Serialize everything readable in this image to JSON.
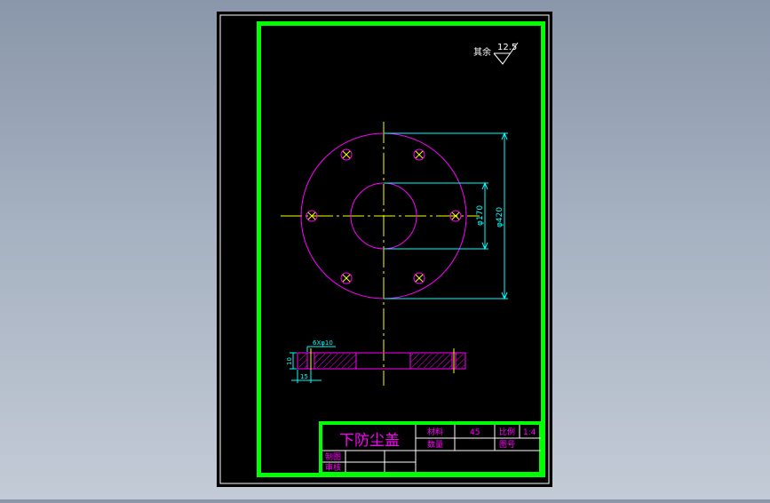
{
  "colors": {
    "background_gradient_top": "#8a97aa",
    "background_gradient_bottom": "#c3cbd6",
    "sheet": "#000000",
    "sheet_border": "#ffffff",
    "drawing_frame": "#00ff00",
    "part_outline": "#ff00ff",
    "centerline": "#ffff00",
    "dimension": "#00ffff",
    "hatch": "#ff00ff",
    "text_yellow": "#ffff00",
    "title_block_lines": "#ffffff"
  },
  "surface_finish": {
    "label": "其余",
    "value": "12.5"
  },
  "dimensions": {
    "inner_diameter": "φ170",
    "outer_diameter": "φ420",
    "hole_spec": "6Xφ10",
    "thickness": "10",
    "hole_offset": "15"
  },
  "title_block": {
    "part_name": "下防尘盖",
    "material_label": "材料",
    "material_value": "45",
    "scale_label": "比例",
    "scale_value": "1:4",
    "quantity_label": "数量",
    "drawing_no_label": "图号",
    "drawn_label": "制图",
    "checked_label": "审核"
  }
}
